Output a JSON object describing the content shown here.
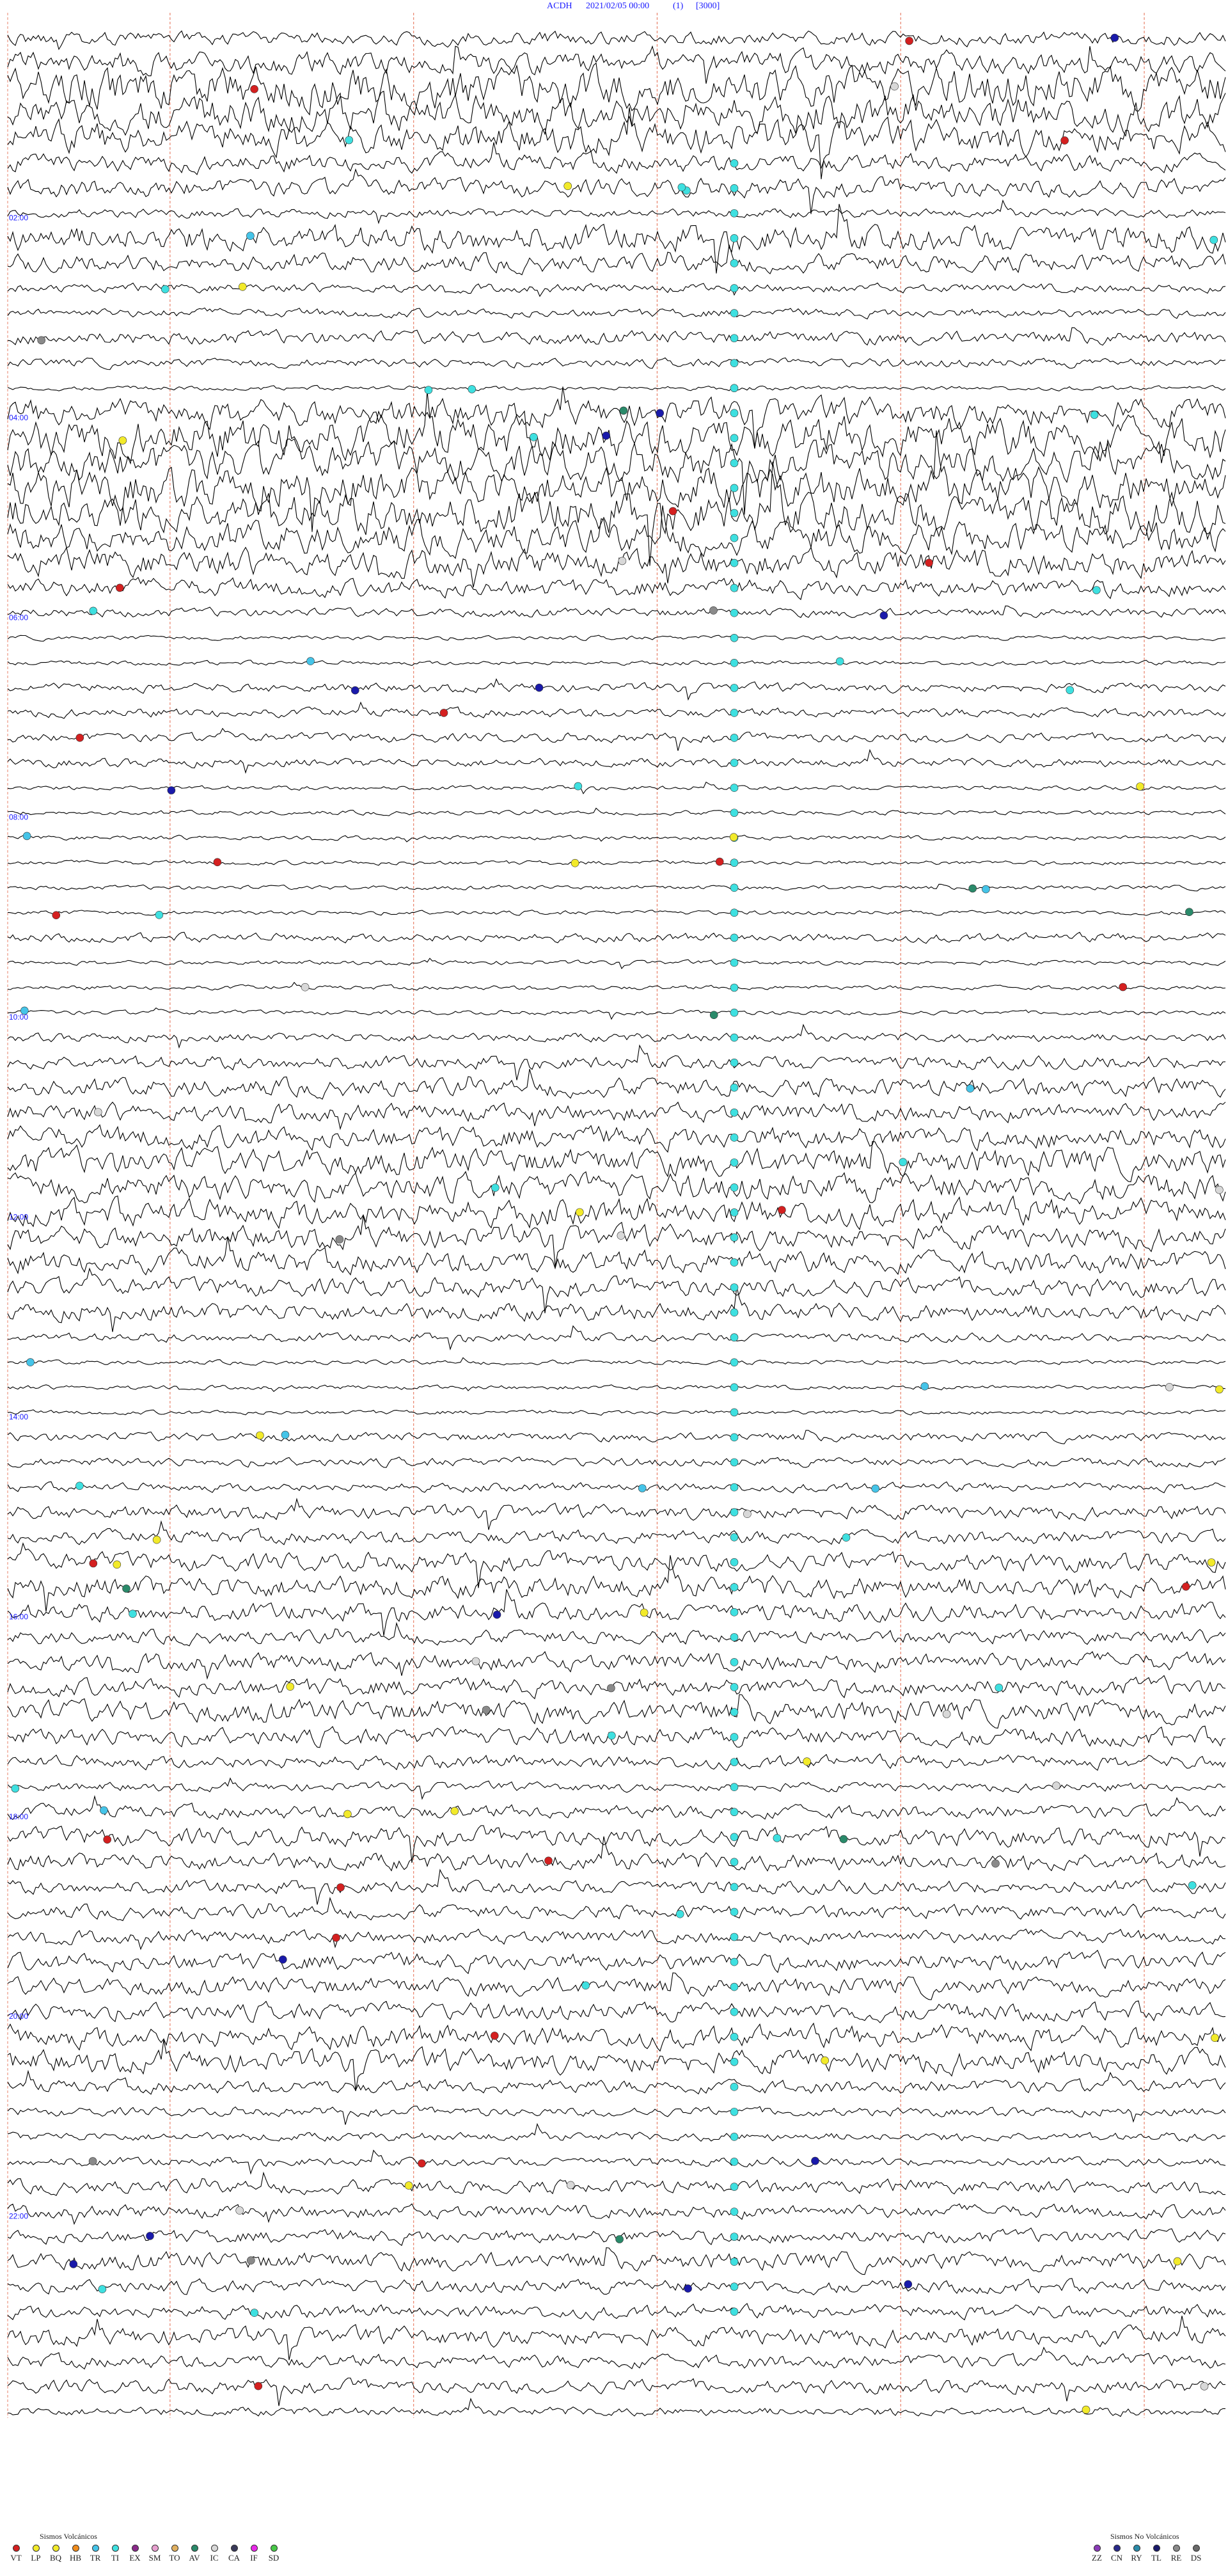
{
  "header": {
    "station": "ACDH",
    "datetime": "2021/02/05 00:00",
    "channel": "(1)",
    "scale": "[3000]"
  },
  "chart_data": {
    "type": "helicorder",
    "title": "ACDH 2021/02/05 00:00 (1) [3000]",
    "hour_labels": [
      "02:00",
      "04:00",
      "06:00",
      "08:00",
      "10:00",
      "12:00",
      "14:00",
      "16:00",
      "18:00",
      "20:00",
      "22:00"
    ],
    "trace_count": 96,
    "minutes_per_line": 15,
    "grid": true,
    "minute_markers": [
      2,
      5,
      8,
      11,
      14
    ],
    "colors": {
      "trace": "#000000",
      "grid": "#e8826a",
      "header": "#1a1aff",
      "tremor": "#3ee0e0"
    },
    "amplitude_profile": [
      3,
      5,
      9,
      8,
      7,
      4,
      4,
      2,
      6,
      4,
      2,
      2,
      3,
      2,
      1,
      6,
      9,
      8,
      9,
      9,
      7,
      6,
      4,
      2,
      1,
      1,
      2,
      2,
      2,
      2,
      1,
      1,
      1,
      1,
      1,
      1,
      2,
      1,
      1,
      1,
      2,
      3,
      4,
      4,
      5,
      6,
      6,
      6,
      5,
      5,
      4,
      4,
      2,
      1,
      1,
      1,
      2,
      2,
      2,
      3,
      3,
      4,
      5,
      4,
      3,
      4,
      4,
      5,
      4,
      3,
      2,
      3,
      4,
      4,
      3,
      3,
      3,
      4,
      4,
      4,
      5,
      5,
      3,
      2,
      2,
      2,
      3,
      3,
      3,
      4,
      3,
      3,
      4,
      3,
      3,
      2
    ]
  },
  "legend_volcanic": {
    "title": "Sismos Volcánicos",
    "items": [
      {
        "label": "VT",
        "color": "#d42020"
      },
      {
        "label": "LP",
        "color": "#f2ea2a"
      },
      {
        "label": "BQ",
        "color": "#f2ea2a"
      },
      {
        "label": "HB",
        "color": "#f08c1c"
      },
      {
        "label": "TR",
        "color": "#45c4e8"
      },
      {
        "label": "TI",
        "color": "#3ee0e0"
      },
      {
        "label": "EX",
        "color": "#8a2a8a"
      },
      {
        "label": "SM",
        "color": "#e8a0d0"
      },
      {
        "label": "TO",
        "color": "#e0b060"
      },
      {
        "label": "AV",
        "color": "#2a8a6a"
      },
      {
        "label": "IC",
        "color": "#d8d8d8"
      },
      {
        "label": "CA",
        "color": "#3a3a5a"
      },
      {
        "label": "IF",
        "color": "#e828e8"
      },
      {
        "label": "SD",
        "color": "#48c848"
      }
    ]
  },
  "legend_nonvolcanic": {
    "title": "Sismos No Volcánicos",
    "items": [
      {
        "label": "ZZ",
        "color": "#8a3ab8"
      },
      {
        "label": "CN",
        "color": "#2a2a8a"
      },
      {
        "label": "RY",
        "color": "#2a8aa8"
      },
      {
        "label": "TL",
        "color": "#1a1a6a"
      },
      {
        "label": "RE",
        "color": "#8a8a8a"
      },
      {
        "label": "DS",
        "color": "#6a6a6a"
      }
    ]
  }
}
